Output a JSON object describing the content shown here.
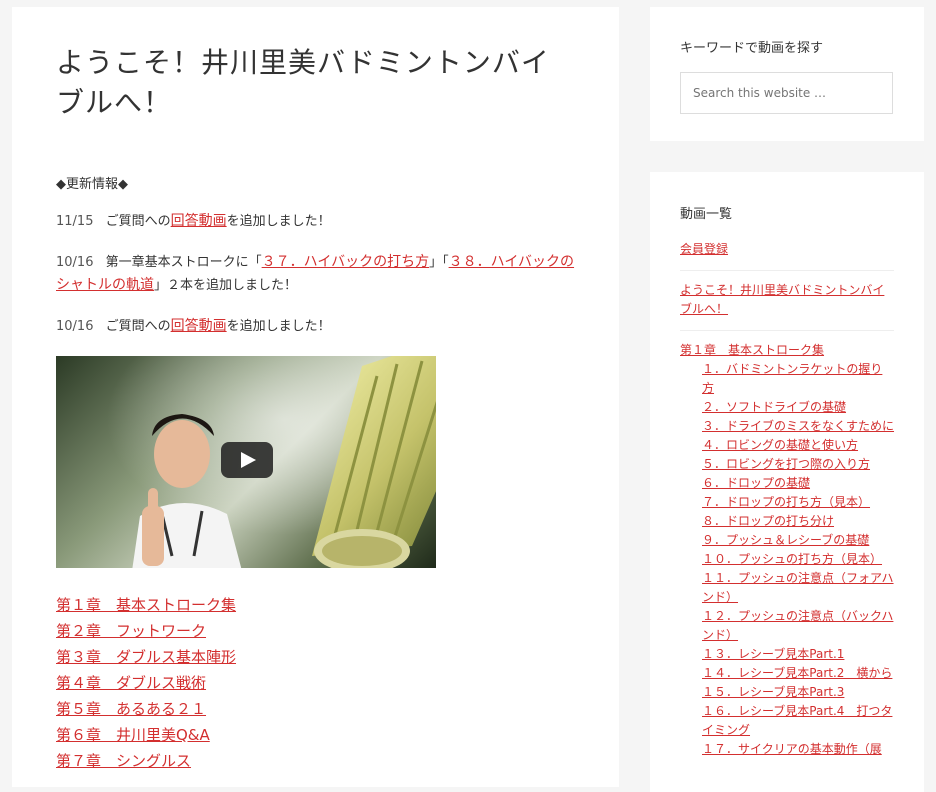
{
  "main": {
    "title": "ようこそ！井川里美バドミントンバイブルへ！",
    "update_head": "◆更新情報◆",
    "updates": [
      {
        "date": "11/15",
        "pre": "ご質問への",
        "link": "回答動画",
        "post": "を追加しました！"
      },
      {
        "date": "10/16",
        "pre": "第一章基本ストロークに「",
        "link": "３７．ハイバックの打ち方",
        "mid": "」「",
        "link2": "３８．ハイバックのシャトルの軌道",
        "post": "」２本を追加しました！"
      },
      {
        "date": "10/16",
        "pre": "ご質問への",
        "link": "回答動画",
        "post": "を追加しました！"
      }
    ],
    "video": {
      "play_icon": "play-icon"
    },
    "chapters": [
      "第１章　基本ストローク集",
      "第２章　フットワーク",
      "第３章　ダブルス基本陣形",
      "第４章　ダブルス戦術",
      "第５章　あるある２１",
      "第６章　井川里美Q&A",
      "第７章　シングルス"
    ]
  },
  "sidebar": {
    "search_title": "キーワードで動画を探す",
    "search_placeholder": "Search this website …",
    "list_title": "動画一覧",
    "register": "会員登録",
    "welcome": "ようこそ！井川里美バドミントンバイブルへ！",
    "chapter1": "第１章　基本ストローク集",
    "items": [
      "１．バドミントンラケットの握り方",
      "２．ソフトドライブの基礎",
      "３．ドライブのミスをなくすために",
      "４．ロビングの基礎と使い方",
      "５．ロビングを打つ際の入り方",
      "６．ドロップの基礎",
      "７．ドロップの打ち方（見本）",
      "８．ドロップの打ち分け",
      "９．プッシュ＆レシーブの基礎",
      "１０．プッシュの打ち方（見本）",
      "１１．プッシュの注意点（フォアハンド）",
      "１２．プッシュの注意点（バックハンド）",
      "１３．レシーブ見本Part.1",
      "１４．レシーブ見本Part.2　横から",
      "１５．レシーブ見本Part.3",
      "１６．レシーブ見本Part.4　打つタイミング",
      "１７．サイクリアの基本動作（展"
    ]
  },
  "colors": {
    "link": "#d32f2f",
    "background": "#f5f5f5"
  }
}
